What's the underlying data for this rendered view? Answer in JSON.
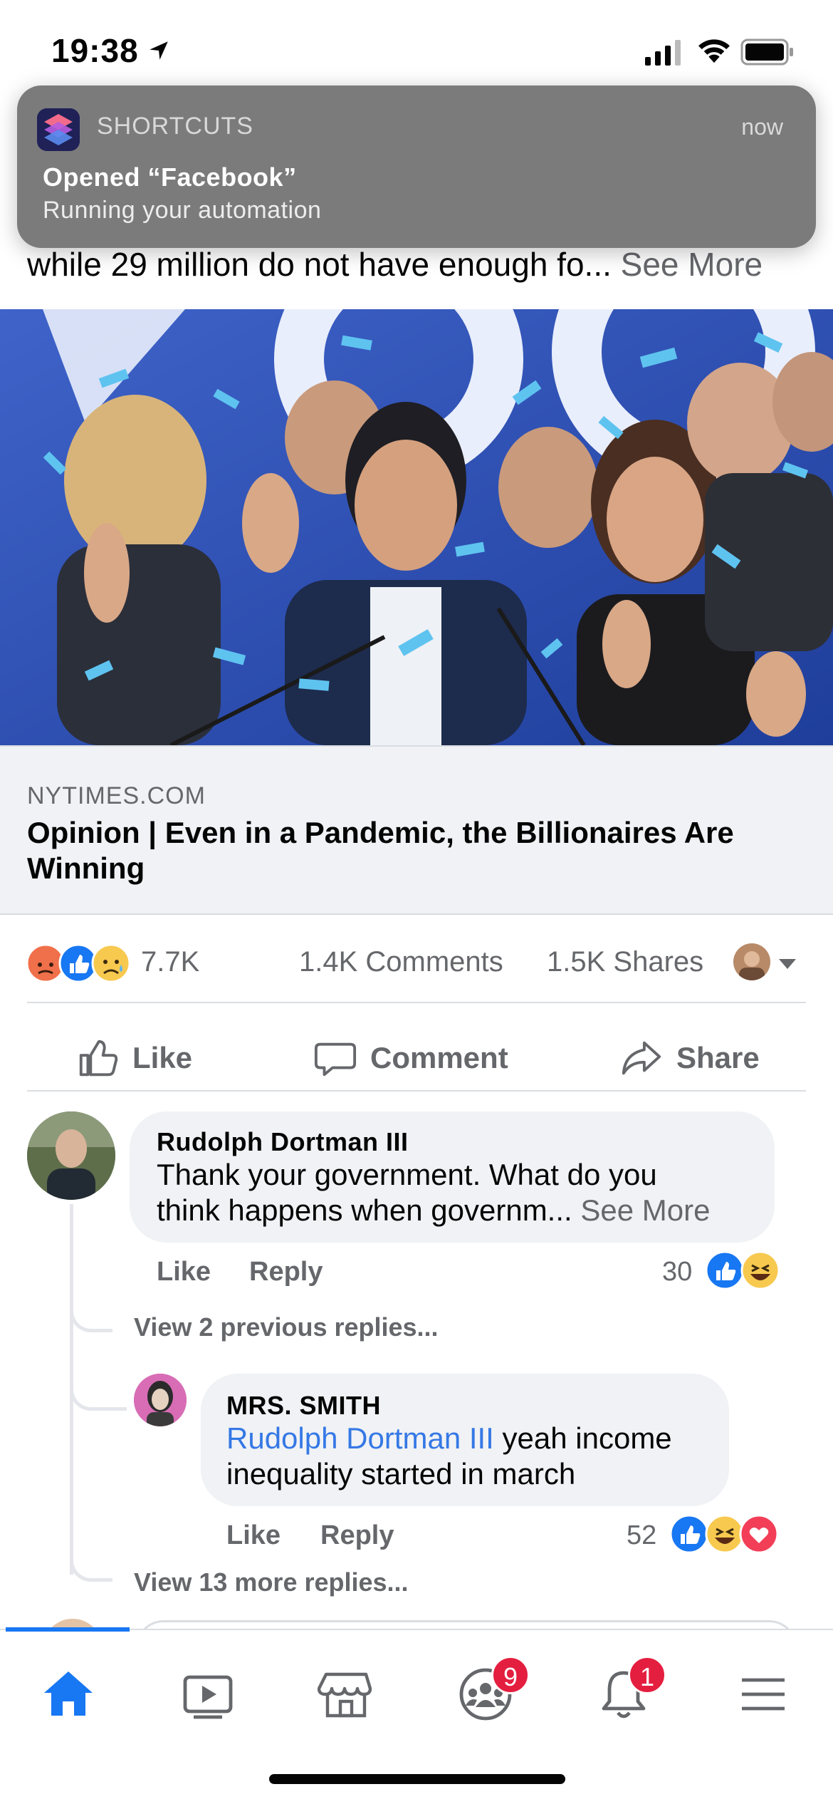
{
  "status_bar": {
    "time": "19:38",
    "icons": [
      "location-arrow-icon",
      "signal-icon",
      "wifi-icon",
      "battery-icon"
    ]
  },
  "notification": {
    "app_name": "SHORTCUTS",
    "time": "now",
    "title": "Opened “Facebook”",
    "body": "Running your automation"
  },
  "post": {
    "text": "while 29 million do not have enough fo... ",
    "see_more": "See More",
    "link": {
      "domain": "NYTIMES.COM",
      "title": "Opinion | Even in a Pandemic, the Billionaires Are Winning"
    },
    "reactions": {
      "icons": [
        "angry-reaction-icon",
        "like-reaction-icon",
        "sad-reaction-icon"
      ],
      "count": "7.7K",
      "comments": "1.4K Comments",
      "shares": "1.5K Shares"
    },
    "actions": {
      "like": "Like",
      "comment": "Comment",
      "share": "Share"
    }
  },
  "comments": [
    {
      "author": "Rudolph Dortman III",
      "text_line1": "Thank your government. What do you",
      "text_line2": "think happens when governm... ",
      "see_more": "See More",
      "like": "Like",
      "reply": "Reply",
      "reaction_count": "30",
      "reaction_icons": [
        "like-reaction-icon",
        "haha-reaction-icon"
      ]
    }
  ],
  "view_previous": "View 2 previous replies...",
  "reply": {
    "author": "MRS. SMITH",
    "mention": "Rudolph Dortman III",
    "text_line1_rest": " yeah income",
    "text_line2": "inequality started  in march",
    "like": "Like",
    "reply": "Reply",
    "reaction_count": "52",
    "reaction_icons": [
      "like-reaction-icon",
      "haha-reaction-icon",
      "love-reaction-icon"
    ]
  },
  "view_more": "View 13 more replies...",
  "tabbar": {
    "tabs": [
      "home-icon",
      "watch-icon",
      "marketplace-icon",
      "groups-icon",
      "notifications-icon",
      "menu-icon"
    ],
    "groups_badge": "9",
    "notifications_badge": "1",
    "active_color": "#1877f2"
  },
  "colors": {
    "accent": "#1877f2",
    "mention": "#3578e5",
    "secondary_text": "#65676b",
    "badge": "#e41e3f"
  }
}
